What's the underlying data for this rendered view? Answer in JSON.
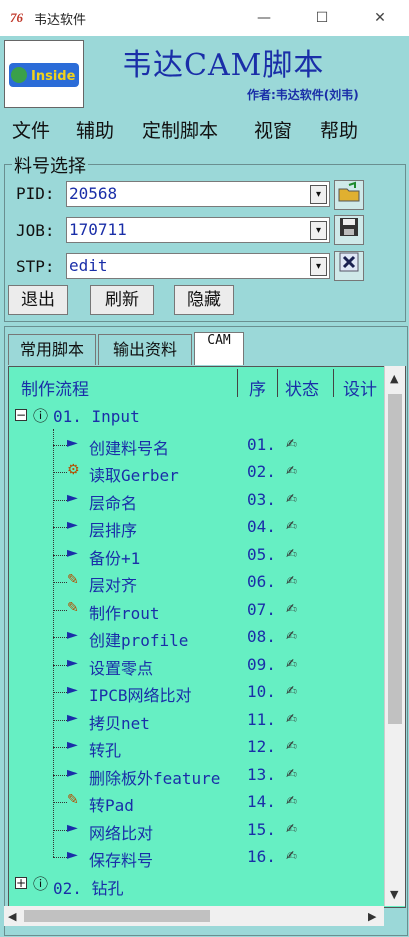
{
  "window": {
    "title": "韦达软件",
    "icon_text": "76"
  },
  "header": {
    "app_title": "韦达CAM脚本",
    "author": "作者:韦达软件(刘韦)",
    "logo_text": "Inside"
  },
  "menu": [
    "文件",
    "辅助",
    "定制脚本",
    "视窗",
    "帮助"
  ],
  "selector": {
    "legend": "料号选择",
    "fields": [
      {
        "label": "PID:",
        "value": "20568"
      },
      {
        "label": "JOB:",
        "value": "170711"
      },
      {
        "label": "STP:",
        "value": "edit"
      }
    ],
    "buttons": [
      "退出",
      "刷新",
      "隐藏"
    ]
  },
  "tabs": [
    {
      "label": "常用脚本",
      "active": false
    },
    {
      "label": "输出资料",
      "active": false
    },
    {
      "label": "CAM",
      "active": true
    }
  ],
  "tree": {
    "columns": [
      "制作流程",
      "序",
      "状态",
      "设计"
    ],
    "groups": [
      {
        "label": "01. Input",
        "expanded": true,
        "items": [
          {
            "label": "创建料号名",
            "seq": "01.",
            "icon": "arrow"
          },
          {
            "label": "读取Gerber",
            "seq": "02.",
            "icon": "gears"
          },
          {
            "label": "层命名",
            "seq": "03.",
            "icon": "arrow"
          },
          {
            "label": "层排序",
            "seq": "04.",
            "icon": "arrow"
          },
          {
            "label": "备份+1",
            "seq": "05.",
            "icon": "arrow"
          },
          {
            "label": "层对齐",
            "seq": "06.",
            "icon": "edit"
          },
          {
            "label": "制作rout",
            "seq": "07.",
            "icon": "edit"
          },
          {
            "label": "创建profile",
            "seq": "08.",
            "icon": "arrow"
          },
          {
            "label": "设置零点",
            "seq": "09.",
            "icon": "arrow"
          },
          {
            "label": "IPCB网络比对",
            "seq": "10.",
            "icon": "arrow"
          },
          {
            "label": "拷贝net",
            "seq": "11.",
            "icon": "arrow"
          },
          {
            "label": "转孔",
            "seq": "12.",
            "icon": "arrow"
          },
          {
            "label": "删除板外feature",
            "seq": "13.",
            "icon": "arrow"
          },
          {
            "label": "转Pad",
            "seq": "14.",
            "icon": "edit"
          },
          {
            "label": "网络比对",
            "seq": "15.",
            "icon": "arrow"
          },
          {
            "label": "保存料号",
            "seq": "16.",
            "icon": "arrow"
          }
        ]
      },
      {
        "label": "02. 钻孔",
        "expanded": false,
        "items": []
      }
    ]
  },
  "colors": {
    "background": "#9bd8d8",
    "tree_bg": "#66efc3",
    "accent": "#1a2ea8"
  }
}
